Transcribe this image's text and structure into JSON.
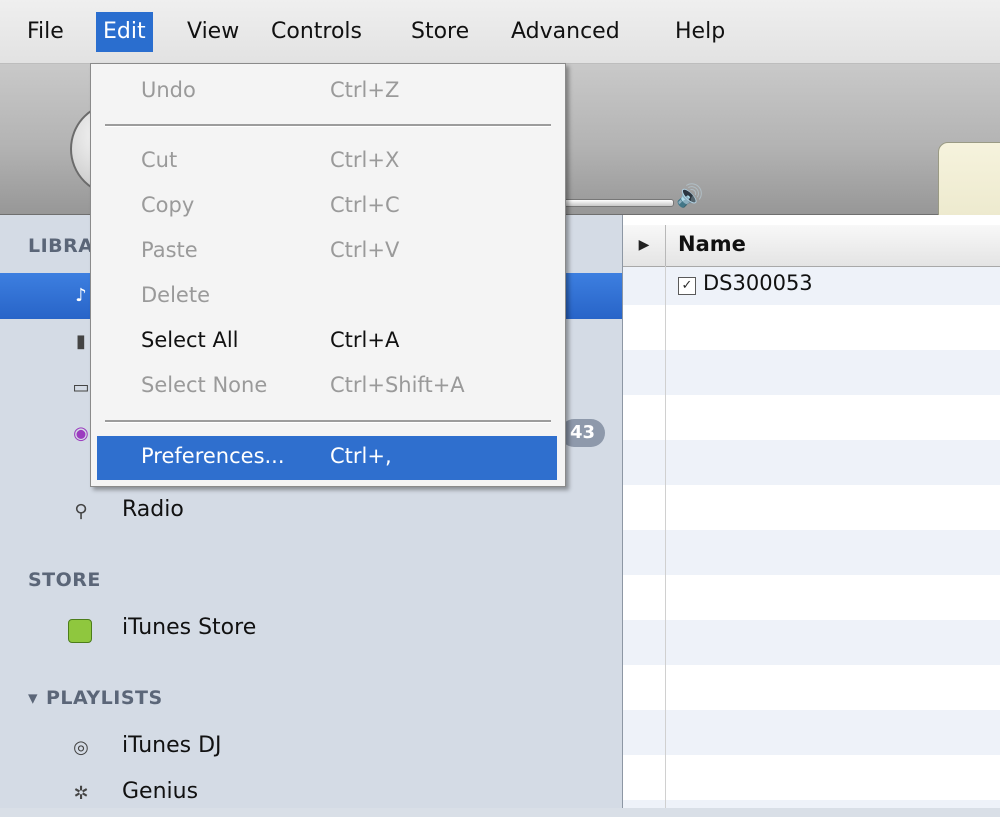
{
  "menubar": {
    "items": [
      "File",
      "Edit",
      "View",
      "Controls",
      "Store",
      "Advanced",
      "Help"
    ],
    "active": "Edit"
  },
  "edit_menu": {
    "items": [
      {
        "label": "Undo",
        "shortcut": "Ctrl+Z",
        "enabled": false
      },
      {
        "label": "Cut",
        "shortcut": "Ctrl+X",
        "enabled": false
      },
      {
        "label": "Copy",
        "shortcut": "Ctrl+C",
        "enabled": false
      },
      {
        "label": "Paste",
        "shortcut": "Ctrl+V",
        "enabled": false
      },
      {
        "label": "Delete",
        "shortcut": "",
        "enabled": false
      },
      {
        "label": "Select All",
        "shortcut": "Ctrl+A",
        "enabled": true
      },
      {
        "label": "Select None",
        "shortcut": "Ctrl+Shift+A",
        "enabled": false
      },
      {
        "label": "Preferences...",
        "shortcut": "Ctrl+,",
        "enabled": true,
        "highlighted": true
      }
    ]
  },
  "sidebar": {
    "library_header": "LIBRARY",
    "store_header": "STORE",
    "playlists_header": "PLAYLISTS",
    "podcast_badge": "43",
    "radio_label": "Radio",
    "store_item": "iTunes Store",
    "playlist_items": [
      "iTunes DJ",
      "Genius"
    ]
  },
  "tracklist": {
    "column_name": "Name",
    "tracks": [
      {
        "name": "DS300053",
        "checked": true
      }
    ]
  },
  "colors": {
    "menu_highlight": "#2f6fce",
    "sidebar_bg": "#d4dbe5",
    "sidebar_selected": "#2864c8"
  },
  "icons": {
    "music": "music-note-icon",
    "movies": "film-icon",
    "tv": "tv-icon",
    "podcasts": "podcast-icon",
    "radio": "radio-antenna-icon",
    "store": "store-bag-icon",
    "dj": "itunes-dj-icon",
    "genius": "genius-atom-icon",
    "volume": "speaker-icon"
  }
}
